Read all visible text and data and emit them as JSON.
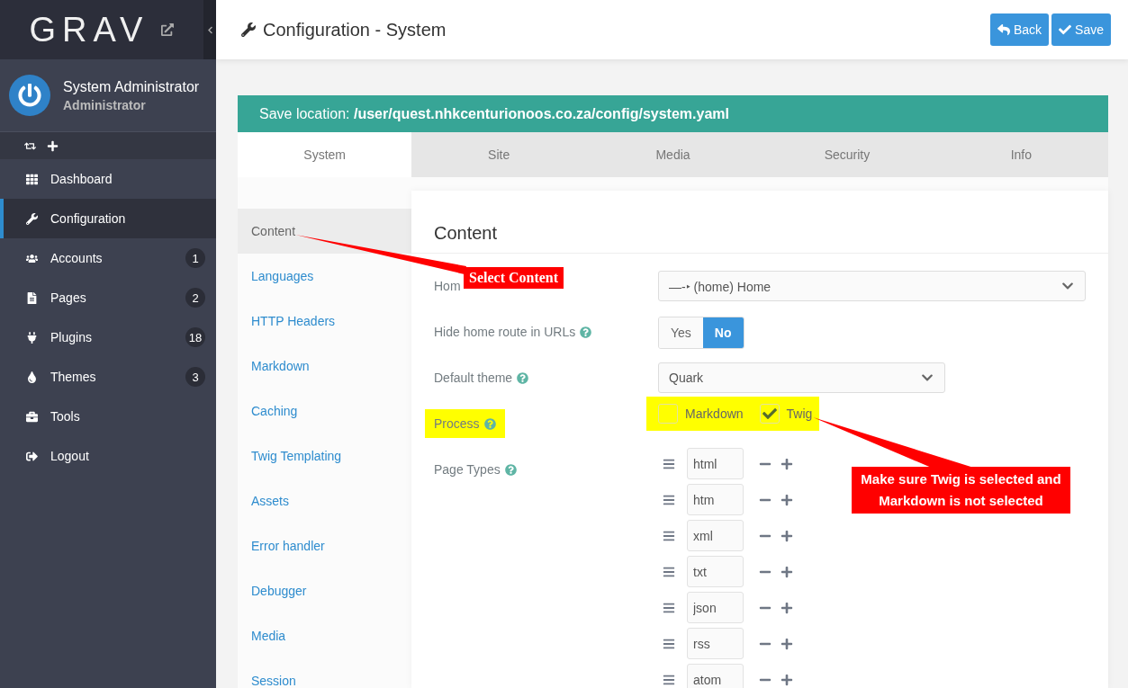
{
  "sidebar": {
    "logo": "GRAV",
    "user": {
      "name": "System Administrator",
      "role": "Administrator"
    },
    "nav": [
      {
        "label": "Dashboard",
        "selected": false
      },
      {
        "label": "Configuration",
        "selected": true
      },
      {
        "label": "Accounts",
        "selected": false,
        "badge": "1"
      },
      {
        "label": "Pages",
        "selected": false,
        "badge": "2"
      },
      {
        "label": "Plugins",
        "selected": false,
        "badge": "18"
      },
      {
        "label": "Themes",
        "selected": false,
        "badge": "3"
      },
      {
        "label": "Tools",
        "selected": false
      },
      {
        "label": "Logout",
        "selected": false
      }
    ]
  },
  "header": {
    "title": "Configuration - System",
    "buttons": [
      {
        "label": "Back",
        "kind": "back"
      },
      {
        "label": "Save",
        "kind": "save"
      }
    ]
  },
  "save_location": "Save location: **/user/quest.nhkcenturionoos.co.za/config/system.yaml**",
  "tabs": [
    {
      "label": "System",
      "selected": true
    },
    {
      "label": "Site",
      "selected": false
    },
    {
      "label": "Media",
      "selected": false
    },
    {
      "label": "Security",
      "selected": false
    },
    {
      "label": "Info",
      "selected": false
    }
  ],
  "section_nav": [
    {
      "label": "Content",
      "selected": true
    },
    {
      "label": "Languages",
      "selected": false
    },
    {
      "label": "HTTP Headers",
      "selected": false
    },
    {
      "label": "Markdown",
      "selected": false
    },
    {
      "label": "Caching",
      "selected": false
    },
    {
      "label": "Twig Templating",
      "selected": false
    },
    {
      "label": "Assets",
      "selected": false
    },
    {
      "label": "Error handler",
      "selected": false
    },
    {
      "label": "Debugger",
      "selected": false
    },
    {
      "label": "Media",
      "selected": false
    },
    {
      "label": "Session",
      "selected": false
    }
  ],
  "form": {
    "heading": "Content",
    "fields": [
      {
        "kind": "select",
        "label": "Hom",
        "wide": true,
        "value": "—-‣ (home) Home"
      },
      {
        "kind": "toggle",
        "label": "Hide home route in URLs",
        "help": true,
        "options": [
          {
            "label": "Yes",
            "selected": false
          },
          {
            "label": "No",
            "selected": true
          }
        ]
      },
      {
        "kind": "select",
        "label": "Default theme",
        "help": true,
        "wide": false,
        "value": "Quark"
      },
      {
        "kind": "checkboxes",
        "label": "Process",
        "help": true,
        "highlighted": true,
        "options": [
          {
            "label": "Markdown",
            "checked": false
          },
          {
            "label": "Twig",
            "checked": true
          }
        ]
      },
      {
        "kind": "list",
        "label": "Page Types",
        "help": true,
        "items": [
          "html",
          "htm",
          "xml",
          "txt",
          "json",
          "rss",
          "atom"
        ]
      }
    ]
  },
  "annotations": [
    {
      "text": "Select Content"
    },
    {
      "text": "Make sure Twig is selected and Markdown is not selected"
    }
  ]
}
